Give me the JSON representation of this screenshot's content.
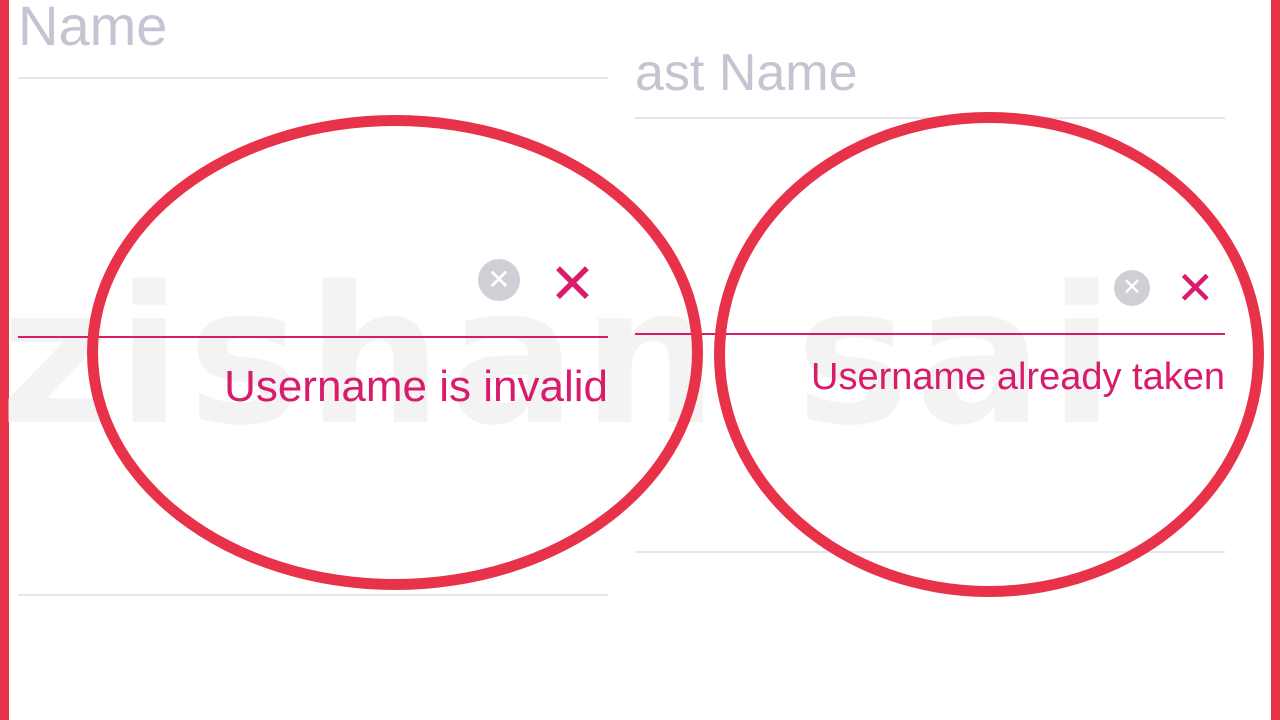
{
  "watermark": "zishan sai",
  "left_form": {
    "field_label": "Name",
    "error_message": "Username is invalid",
    "clear_icon": "clear-icon",
    "error_icon": "error-x-icon"
  },
  "right_form": {
    "field_label": "ast Name",
    "error_message": "Username already taken",
    "clear_icon": "clear-icon",
    "error_icon": "error-x-icon"
  },
  "colors": {
    "highlight_circle": "#e8324a",
    "error": "#d81b6a",
    "placeholder": "#c3c6d2"
  }
}
